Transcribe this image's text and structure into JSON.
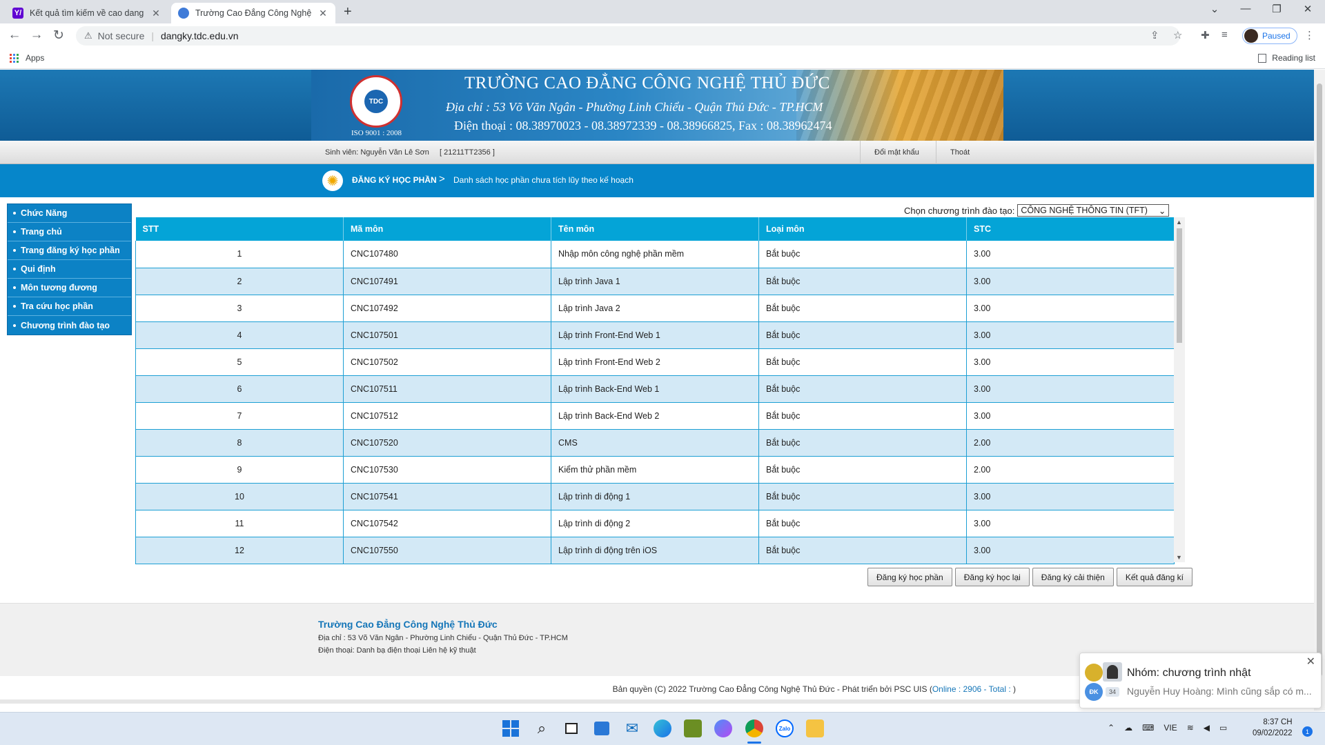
{
  "browser": {
    "tabs": [
      {
        "title": "Kết quả tìm kiếm về cao dang co",
        "icon": "yahoo-icon",
        "favicon_text": "Y/"
      },
      {
        "title": "Trường Cao Đẳng Công Nghệ Thủ",
        "icon": "globe-icon",
        "favicon_text": ""
      }
    ],
    "security_label": "Not secure",
    "url": "dangky.tdc.edu.vn",
    "profile_status": "Paused",
    "bookmarks": {
      "apps_label": "Apps",
      "reading_list_label": "Reading list"
    }
  },
  "header": {
    "school_name": "TRƯỜNG CAO ĐẲNG CÔNG NGHỆ THỦ ĐỨC",
    "address": "Địa chỉ : 53 Võ Văn Ngân - Phường Linh Chiểu - Quận Thủ Đức - TP.HCM",
    "phone": "Điện thoại : 08.38970023 - 08.38972339 - 08.38966825, Fax : 08.38962474",
    "iso": "ISO 9001 : 2008",
    "logo_text": "TDC"
  },
  "userbar": {
    "student_label": "Sinh viên: Nguyễn Văn Lê Sơn",
    "student_id": "[ 21211TT2356 ]",
    "change_password": "Đổi mật khẩu",
    "logout": "Thoát"
  },
  "breadcrumb": {
    "main": "ĐĂNG KÝ HỌC PHẦN",
    "separator": ">",
    "sub": "Danh sách học phần chưa tích lũy theo kế hoạch"
  },
  "sidebar": {
    "items": [
      {
        "label": "Chức Năng"
      },
      {
        "label": "Trang chủ"
      },
      {
        "label": "Trang đăng ký học phần"
      },
      {
        "label": "Qui định"
      },
      {
        "label": "Môn tương đương"
      },
      {
        "label": "Tra cứu học phần"
      },
      {
        "label": "Chương trình đào tạo"
      }
    ]
  },
  "program": {
    "label": "Chọn chương trình đào tạo:",
    "selected": "CÔNG NGHỆ THÔNG TIN (TFT)"
  },
  "table": {
    "headers": [
      "STT",
      "Mã môn",
      "Tên môn",
      "Loại môn",
      "STC"
    ],
    "rows": [
      [
        "1",
        "CNC107480",
        "Nhập môn công nghệ phần mềm",
        "Bắt buộc",
        "3.00"
      ],
      [
        "2",
        "CNC107491",
        "Lập trình Java 1",
        "Bắt buộc",
        "3.00"
      ],
      [
        "3",
        "CNC107492",
        "Lập trình Java 2",
        "Bắt buộc",
        "3.00"
      ],
      [
        "4",
        "CNC107501",
        "Lập trình Front-End Web 1",
        "Bắt buộc",
        "3.00"
      ],
      [
        "5",
        "CNC107502",
        "Lập trình Front-End Web 2",
        "Bắt buộc",
        "3.00"
      ],
      [
        "6",
        "CNC107511",
        "Lập trình Back-End Web 1",
        "Bắt buộc",
        "3.00"
      ],
      [
        "7",
        "CNC107512",
        "Lập trình Back-End Web 2",
        "Bắt buộc",
        "3.00"
      ],
      [
        "8",
        "CNC107520",
        "CMS",
        "Bắt buộc",
        "2.00"
      ],
      [
        "9",
        "CNC107530",
        "Kiểm thử phần mềm",
        "Bắt buộc",
        "2.00"
      ],
      [
        "10",
        "CNC107541",
        "Lập trình di động 1",
        "Bắt buộc",
        "3.00"
      ],
      [
        "11",
        "CNC107542",
        "Lập trình di động 2",
        "Bắt buộc",
        "3.00"
      ],
      [
        "12",
        "CNC107550",
        "Lập trình di động trên iOS",
        "Bắt buộc",
        "3.00"
      ]
    ]
  },
  "actions": {
    "register": "Đăng ký học phần",
    "retake": "Đăng ký học lại",
    "improve": "Đăng ký cải thiện",
    "results": "Kết quả đăng kí"
  },
  "footer": {
    "name": "Trường Cao Đẳng Công Nghệ Thủ Đức",
    "address": "Địa chỉ : 53 Võ Văn Ngân - Phường Linh Chiểu - Quận Thủ Đức - TP.HCM",
    "phone": "Điện thoại: Danh bạ điện thoại Liên hệ kỹ thuật",
    "copyright": "Bản quyền (C) 2022 Trường Cao Đẳng Công Nghệ Thủ Đức - Phát triển bởi PSC UIS (",
    "online": "Online : 2906 - Total : ",
    "copyright_end": ")"
  },
  "notification": {
    "title": "Nhóm: chương trình nhật",
    "message": "Nguyễn Huy Hoàng: Mình cũng sắp có m...",
    "avatar_initials": "ĐK",
    "count": "34"
  },
  "taskbar": {
    "language": "VIE",
    "time": "8:37 CH",
    "date": "09/02/2022",
    "notification_count": "1",
    "zalo_label": "Zalo"
  },
  "colors": {
    "header_blue": "#0686ca",
    "table_header": "#04a4d7",
    "row_alt": "#d3e9f6",
    "sidebar": "#0c82c5",
    "link_blue": "#1576b8"
  }
}
